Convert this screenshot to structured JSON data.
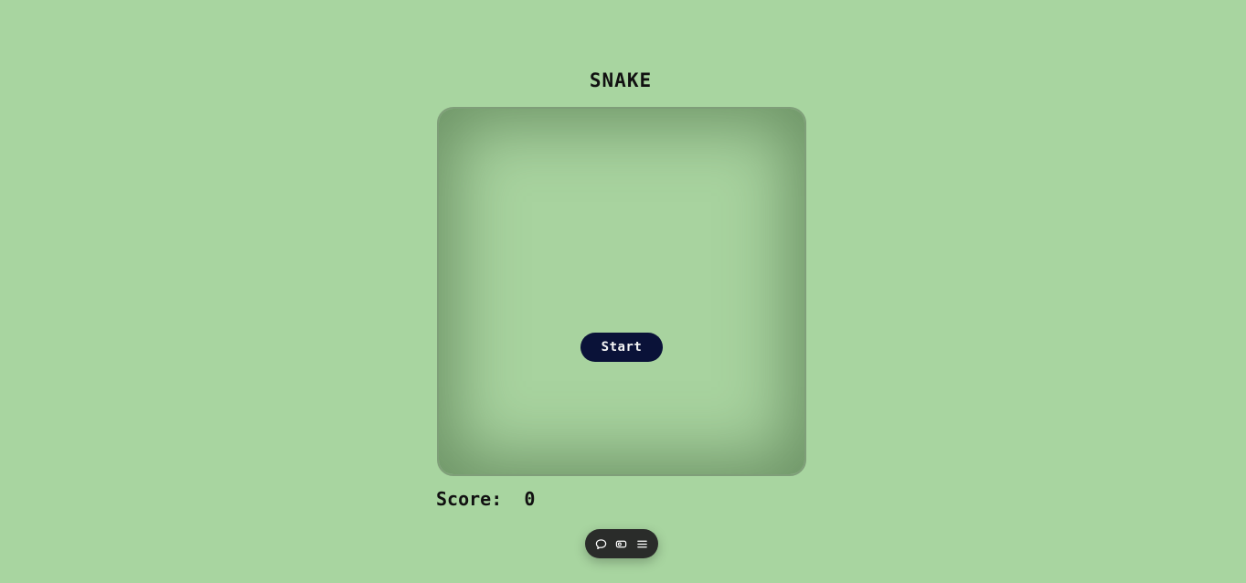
{
  "game": {
    "title": "SNAKE",
    "start_label": "Start",
    "score_label": "Score:",
    "score_value": "0"
  },
  "toolbar": {
    "icons": [
      "chat-icon",
      "toggle-icon",
      "menu-icon"
    ]
  },
  "colors": {
    "background": "#a8d5a0",
    "start_button": "#0a1238",
    "toolbar": "#2a2c2a"
  }
}
